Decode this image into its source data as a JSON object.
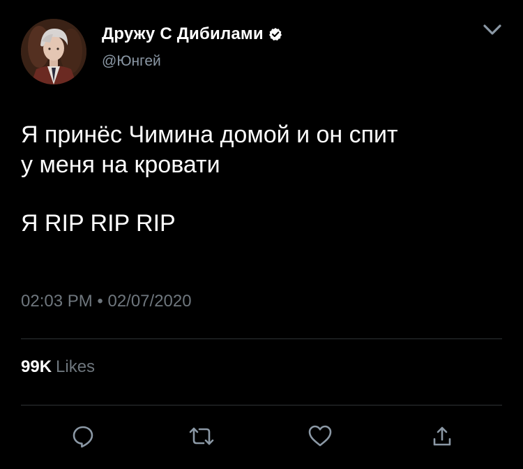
{
  "author": {
    "display_name": "Дружу С Дибилами",
    "handle": "@Юнгей",
    "verified": true
  },
  "tweet": {
    "line1": "Я принёс Чимина домой и он спит",
    "line2": "у меня на кровати",
    "line3": "Я RIP RIP RIP",
    "timestamp": "02:03 PM • 02/07/2020"
  },
  "stats": {
    "likes_count": "99K",
    "likes_label": "Likes"
  },
  "actions": [
    "reply-icon",
    "retweet-icon",
    "like-icon",
    "share-icon"
  ],
  "colors": {
    "background": "#000000",
    "text": "#ffffff",
    "secondary_text": "#6e767d",
    "divider": "#2f3336",
    "icon": "#8b98a5"
  }
}
